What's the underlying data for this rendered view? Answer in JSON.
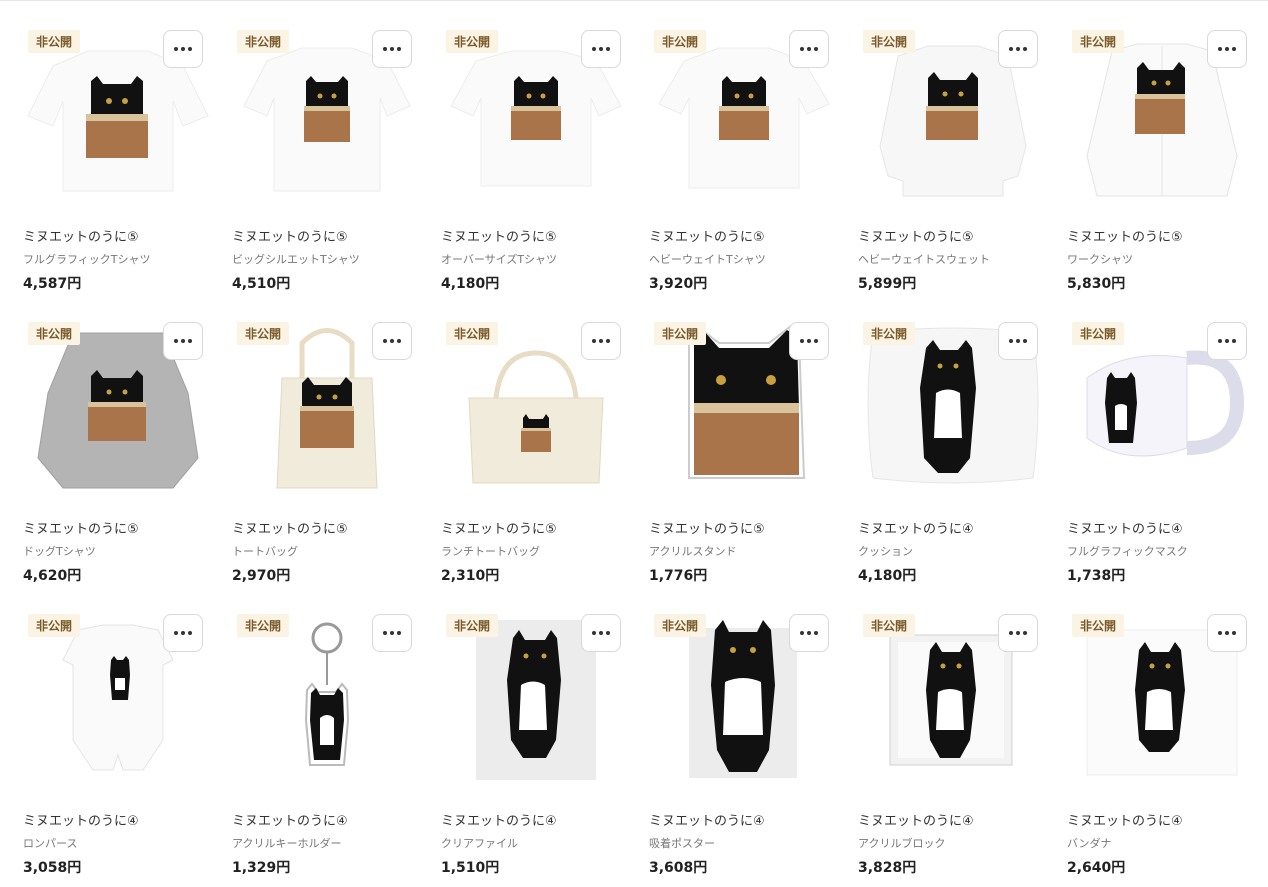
{
  "badge_label": "非公開",
  "products": [
    {
      "title": "ミヌエットのうに⑤",
      "type": "フルグラフィックTシャツ",
      "price": "4,587円"
    },
    {
      "title": "ミヌエットのうに⑤",
      "type": "ビッグシルエットTシャツ",
      "price": "4,510円"
    },
    {
      "title": "ミヌエットのうに⑤",
      "type": "オーバーサイズTシャツ",
      "price": "4,180円"
    },
    {
      "title": "ミヌエットのうに⑤",
      "type": "ヘビーウェイトTシャツ",
      "price": "3,920円"
    },
    {
      "title": "ミヌエットのうに⑤",
      "type": "ヘビーウェイトスウェット",
      "price": "5,899円"
    },
    {
      "title": "ミヌエットのうに⑤",
      "type": "ワークシャツ",
      "price": "5,830円"
    },
    {
      "title": "ミヌエットのうに⑤",
      "type": "ドッグTシャツ",
      "price": "4,620円"
    },
    {
      "title": "ミヌエットのうに⑤",
      "type": "トートバッグ",
      "price": "2,970円"
    },
    {
      "title": "ミヌエットのうに⑤",
      "type": "ランチトートバッグ",
      "price": "2,310円"
    },
    {
      "title": "ミヌエットのうに⑤",
      "type": "アクリルスタンド",
      "price": "1,776円"
    },
    {
      "title": "ミヌエットのうに④",
      "type": "クッション",
      "price": "4,180円"
    },
    {
      "title": "ミヌエットのうに④",
      "type": "フルグラフィックマスク",
      "price": "1,738円"
    },
    {
      "title": "ミヌエットのうに④",
      "type": "ロンパース",
      "price": "3,058円"
    },
    {
      "title": "ミヌエットのうに④",
      "type": "アクリルキーホルダー",
      "price": "1,329円"
    },
    {
      "title": "ミヌエットのうに④",
      "type": "クリアファイル",
      "price": "1,510円"
    },
    {
      "title": "ミヌエットのうに④",
      "type": "吸着ポスター",
      "price": "3,608円"
    },
    {
      "title": "ミヌエットのうに④",
      "type": "アクリルブロック",
      "price": "3,828円"
    },
    {
      "title": "ミヌエットのうに④",
      "type": "バンダナ",
      "price": "2,640円"
    }
  ]
}
